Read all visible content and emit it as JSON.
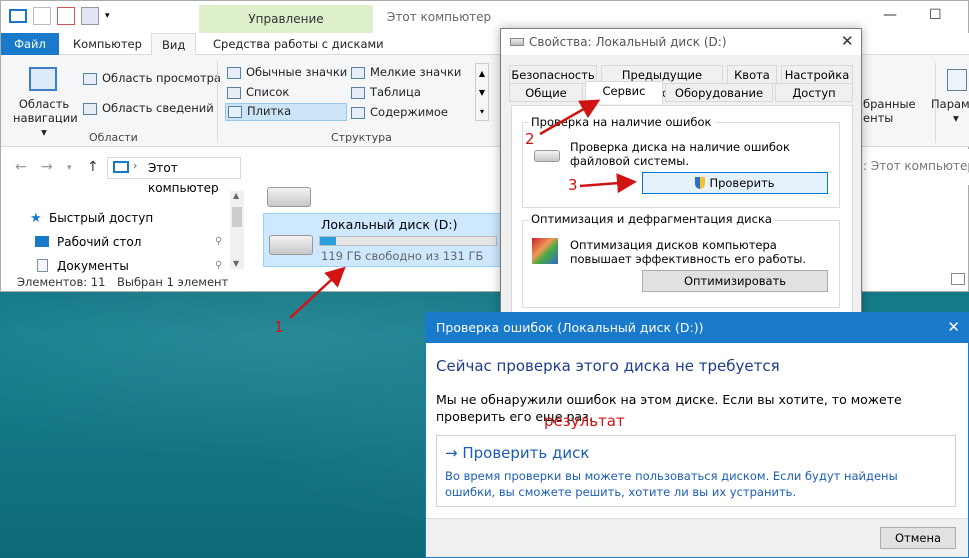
{
  "explorer": {
    "context_tab": "Управление",
    "title": "Этот компьютер",
    "tabs": [
      "Файл",
      "Компьютер",
      "Вид",
      "Средства работы с дисками"
    ],
    "ribbon": {
      "nav_pane_label": "Область навигации ▾",
      "preview_pane": "Область просмотра",
      "details_pane": "Область сведений",
      "group_areas": "Области",
      "group_structure": "Структура",
      "layout_items": [
        "Обычные значки",
        "Мелкие значки",
        "Список",
        "Таблица",
        "Плитка",
        "Содержимое"
      ],
      "right_partial_1": "бранные",
      "right_partial_2": "енты",
      "right_partial_3": "Парамет"
    },
    "address": {
      "path": "Этот компьютер",
      "search_partial": ": Этот компьютер"
    },
    "nav_items": [
      "Быстрый доступ",
      "Рабочий стол",
      "Документы"
    ],
    "drive": {
      "name": "Локальный диск (D:)",
      "free": "119 ГБ свободно из 131 ГБ",
      "used_fraction": 0.092
    },
    "status": {
      "count": "Элементов: 11",
      "selected": "Выбран 1 элемент"
    }
  },
  "props": {
    "title": "Свойства: Локальный диск (D:)",
    "tabs_row1": [
      "Безопасность",
      "Предыдущие версии",
      "Квота",
      "Настройка"
    ],
    "tabs_row2": [
      "Общие",
      "Сервис",
      "Оборудование",
      "Доступ"
    ],
    "check_group": "Проверка на наличие ошибок",
    "check_desc": "Проверка диска на наличие ошибок файловой системы.",
    "check_button": "Проверить",
    "opt_group": "Оптимизация и дефрагментация диска",
    "opt_desc": "Оптимизация дисков компьютера повышает эффективность его работы.",
    "opt_button": "Оптимизировать"
  },
  "check_dialog": {
    "title": "Проверка ошибок (Локальный диск (D:))",
    "heading": "Сейчас проверка этого диска не требуется",
    "message": "Мы не обнаружили ошибок на этом диске. Если вы хотите, то можете проверить его еще раз.",
    "action_title": "Проверить диск",
    "action_desc": "Во время проверки вы можете пользоваться диском. Если будут найдены ошибки, вы сможете решить, хотите ли вы их устранить.",
    "cancel": "Отмена"
  },
  "annotations": {
    "a1": "1",
    "a2": "2",
    "a3": "3",
    "result": "результат"
  },
  "colors": {
    "accent": "#1979ca",
    "annotation": "#d01414"
  }
}
